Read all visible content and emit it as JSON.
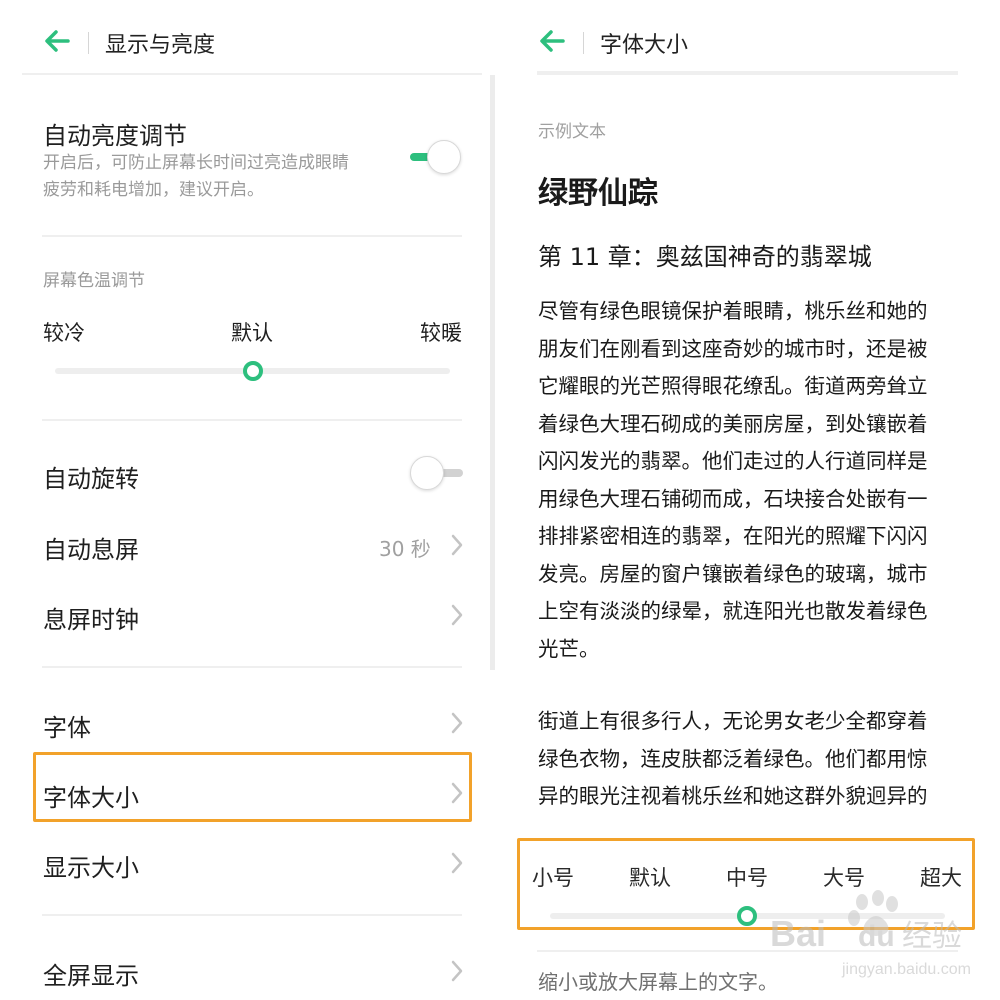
{
  "accent_color": "#2dbf7e",
  "highlight_color": "#f2a22a",
  "display": {
    "title": "显示与亮度",
    "auto_brightness": {
      "label": "自动亮度调节",
      "desc_line1": "开启后，可防止屏幕长时间过亮造成眼睛",
      "desc_line2": "疲劳和耗电增加，建议开启。",
      "enabled": true
    },
    "color_temp": {
      "section_label": "屏幕色温调节",
      "cool": "较冷",
      "default": "默认",
      "warm": "较暖",
      "value_fraction": 0.5
    },
    "auto_rotate": {
      "label": "自动旋转",
      "enabled": false
    },
    "screen_timeout": {
      "label": "自动息屏",
      "value": "30 秒"
    },
    "aod_clock": {
      "label": "息屏时钟"
    },
    "font": {
      "label": "字体"
    },
    "font_size": {
      "label": "字体大小"
    },
    "display_size": {
      "label": "显示大小"
    },
    "full_screen": {
      "label": "全屏显示"
    }
  },
  "font_size_page": {
    "title": "字体大小",
    "sample_caption": "示例文本",
    "book_title": "绿野仙踪",
    "chapter": "第 11 章：奥兹国神奇的翡翠城",
    "paragraph1_lines": [
      "尽管有绿色眼镜保护着眼睛，桃乐丝和她的",
      "朋友们在刚看到这座奇妙的城市时，还是被",
      "它耀眼的光芒照得眼花缭乱。街道两旁耸立",
      "着绿色大理石砌成的美丽房屋，到处镶嵌着",
      "闪闪发光的翡翠。他们走过的人行道同样是",
      "用绿色大理石铺砌而成，石块接合处嵌有一",
      "排排紧密相连的翡翠，在阳光的照耀下闪闪",
      "发亮。房屋的窗户镶嵌着绿色的玻璃，城市",
      "上空有淡淡的绿晕，就连阳光也散发着绿色",
      "光芒。"
    ],
    "paragraph2_lines": [
      "街道上有很多行人，无论男女老少全都穿着",
      "绿色衣物，连皮肤都泛着绿色。他们都用惊",
      "异的眼光注视着桃乐丝和她这群外貌迥异的"
    ],
    "sizes": [
      "小号",
      "默认",
      "中号",
      "大号",
      "超大"
    ],
    "selected_size": "中号",
    "selected_fraction": 0.5,
    "hint": "缩小或放大屏幕上的文字。"
  },
  "watermark": {
    "brand": "Bai",
    "brand_du": "du",
    "jingyan": "经验",
    "url": "jingyan.baidu.com"
  }
}
